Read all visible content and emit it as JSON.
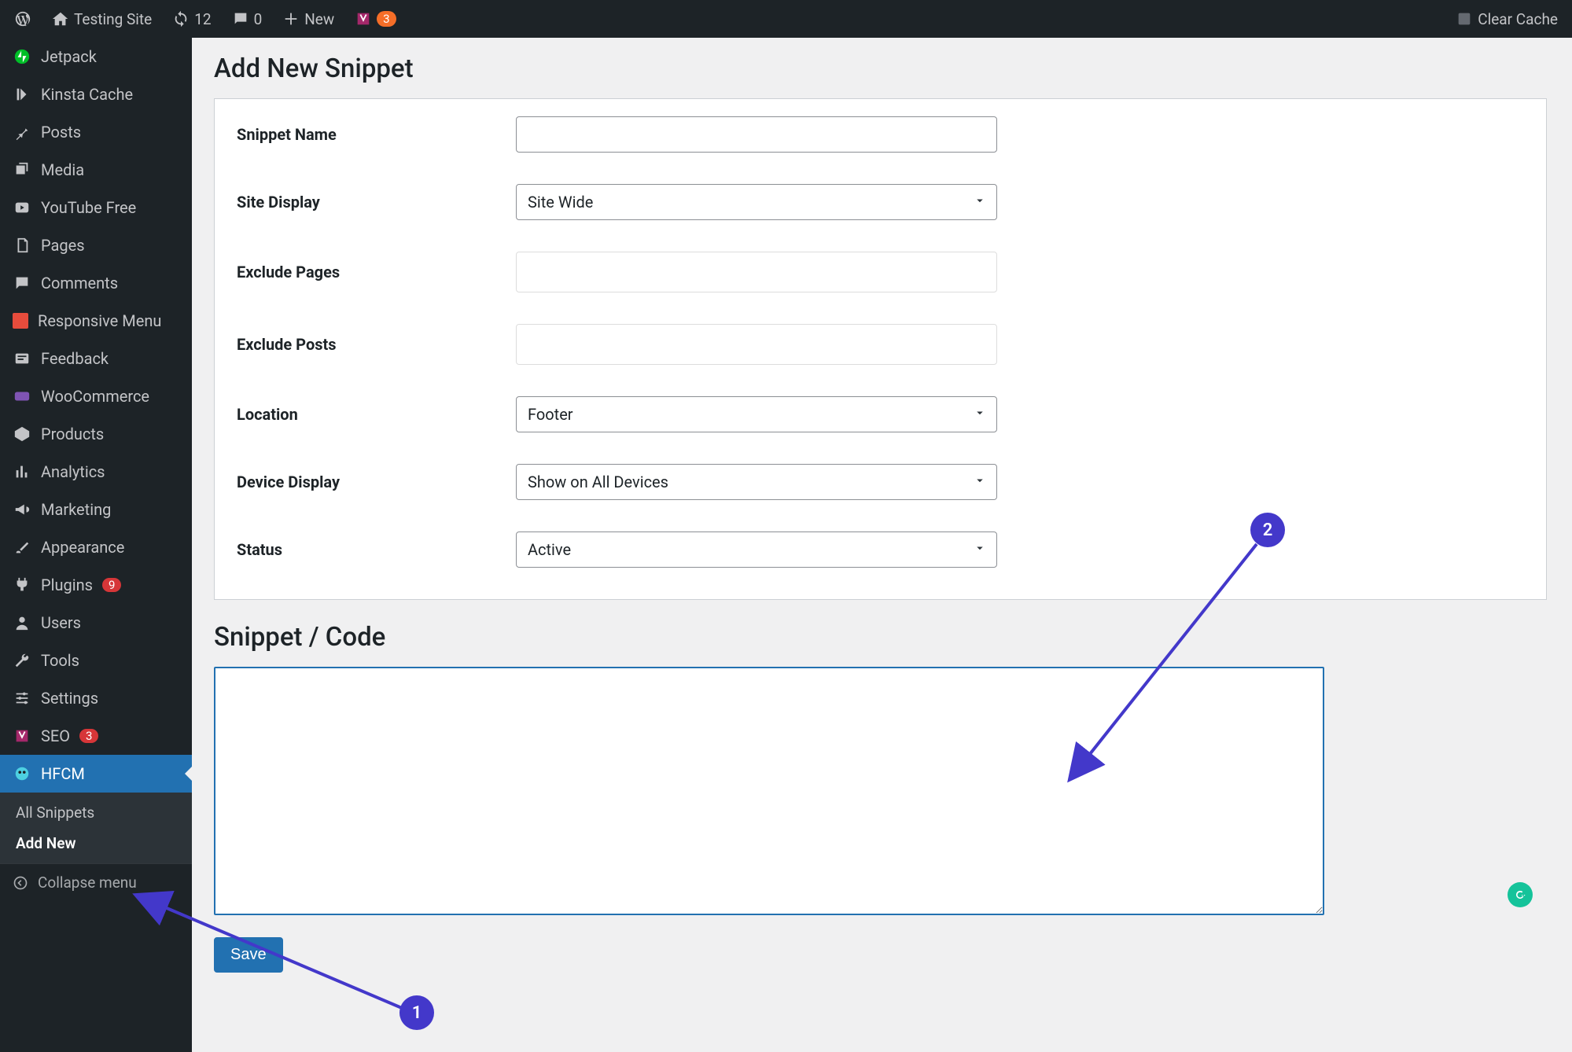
{
  "adminbar": {
    "site_name": "Testing Site",
    "updates_count": "12",
    "comments_count": "0",
    "new_label": "New",
    "yoast_badge": "3",
    "clear_cache": "Clear Cache"
  },
  "sidebar": {
    "items": [
      {
        "label": "Jetpack",
        "icon": "jetpack"
      },
      {
        "label": "Kinsta Cache",
        "icon": "kinsta"
      },
      {
        "label": "Posts",
        "icon": "pin"
      },
      {
        "label": "Media",
        "icon": "media"
      },
      {
        "label": "YouTube Free",
        "icon": "youtube"
      },
      {
        "label": "Pages",
        "icon": "pages"
      },
      {
        "label": "Comments",
        "icon": "comment"
      },
      {
        "label": "Responsive Menu",
        "icon": "rmenu"
      },
      {
        "label": "Feedback",
        "icon": "feedback"
      },
      {
        "label": "WooCommerce",
        "icon": "woo"
      },
      {
        "label": "Products",
        "icon": "products"
      },
      {
        "label": "Analytics",
        "icon": "analytics"
      },
      {
        "label": "Marketing",
        "icon": "marketing"
      },
      {
        "label": "Appearance",
        "icon": "appearance"
      },
      {
        "label": "Plugins",
        "icon": "plugins",
        "badge": "9"
      },
      {
        "label": "Users",
        "icon": "users"
      },
      {
        "label": "Tools",
        "icon": "tools"
      },
      {
        "label": "Settings",
        "icon": "settings"
      },
      {
        "label": "SEO",
        "icon": "seo",
        "badge": "3"
      },
      {
        "label": "HFCM",
        "icon": "hfcm",
        "active": true
      }
    ],
    "submenu": {
      "items": [
        {
          "label": "All Snippets"
        },
        {
          "label": "Add New",
          "current": true
        }
      ]
    },
    "collapse_label": "Collapse menu"
  },
  "page": {
    "title": "Add New Snippet",
    "section_code_title": "Snippet / Code",
    "save_label": "Save"
  },
  "form": {
    "snippet_name": {
      "label": "Snippet Name",
      "value": ""
    },
    "site_display": {
      "label": "Site Display",
      "value": "Site Wide"
    },
    "exclude_pages": {
      "label": "Exclude Pages"
    },
    "exclude_posts": {
      "label": "Exclude Posts"
    },
    "location": {
      "label": "Location",
      "value": "Footer"
    },
    "device_display": {
      "label": "Device Display",
      "value": "Show on All Devices"
    },
    "status": {
      "label": "Status",
      "value": "Active"
    }
  },
  "annotations": {
    "one": "1",
    "two": "2"
  }
}
